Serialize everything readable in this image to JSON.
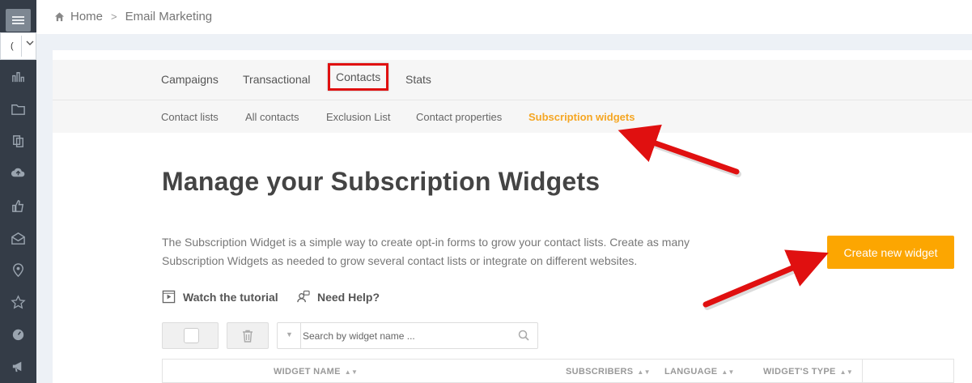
{
  "sidebar": {
    "account_select_value": "(",
    "icons": [
      "bar-chart-icon",
      "folder-icon",
      "copy-icon",
      "cloud-upload-icon",
      "thumbs-up-icon",
      "envelope-open-icon",
      "map-marker-icon",
      "star-icon",
      "dashboard-icon",
      "megaphone-icon"
    ]
  },
  "breadcrumb": {
    "home": "Home",
    "separator": ">",
    "current": "Email Marketing"
  },
  "nav": {
    "tabs": [
      {
        "label": "Campaigns"
      },
      {
        "label": "Transactional"
      },
      {
        "label": "Contacts"
      },
      {
        "label": "Stats"
      }
    ],
    "subtabs": [
      {
        "label": "Contact lists"
      },
      {
        "label": "All contacts"
      },
      {
        "label": "Exclusion List"
      },
      {
        "label": "Contact properties"
      },
      {
        "label": "Subscription widgets"
      }
    ]
  },
  "page": {
    "title": "Manage your Subscription Widgets",
    "description": "The Subscription Widget is a simple way to create opt-in forms to grow your contact lists. Create as many Subscription Widgets as needed to grow several contact lists or integrate on different websites.",
    "create_button": "Create new widget",
    "watch_tutorial": "Watch the tutorial",
    "need_help": "Need Help?"
  },
  "search": {
    "placeholder": "Search by widget name ..."
  },
  "table": {
    "columns": [
      "WIDGET NAME",
      "SUBSCRIBERS",
      "LANGUAGE",
      "WIDGET'S TYPE"
    ],
    "sort_glyph": "▲▼"
  },
  "colors": {
    "accent": "#fca601",
    "highlight_annotation": "#e01010",
    "sidebar_bg": "#343c47"
  }
}
